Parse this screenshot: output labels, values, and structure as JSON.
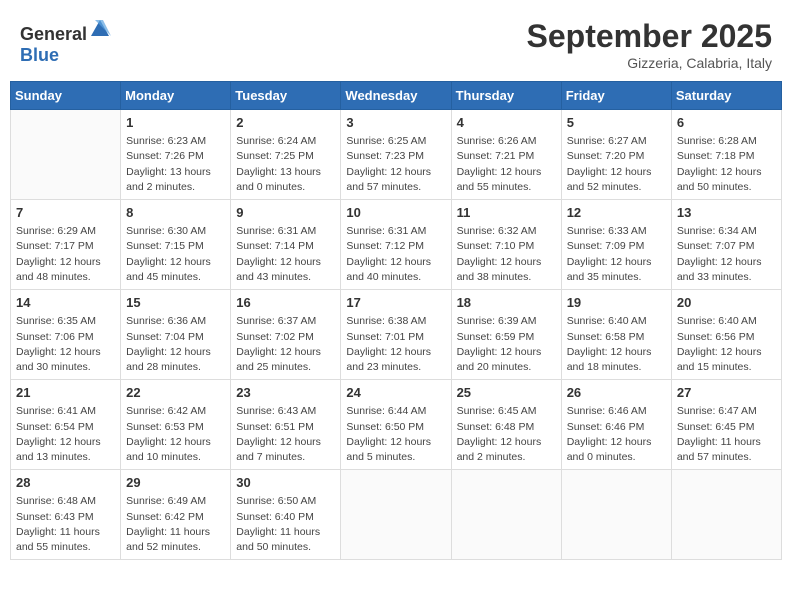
{
  "header": {
    "logo_general": "General",
    "logo_blue": "Blue",
    "month": "September 2025",
    "location": "Gizzeria, Calabria, Italy"
  },
  "weekdays": [
    "Sunday",
    "Monday",
    "Tuesday",
    "Wednesday",
    "Thursday",
    "Friday",
    "Saturday"
  ],
  "weeks": [
    [
      {
        "day": "",
        "info": ""
      },
      {
        "day": "1",
        "info": "Sunrise: 6:23 AM\nSunset: 7:26 PM\nDaylight: 13 hours\nand 2 minutes."
      },
      {
        "day": "2",
        "info": "Sunrise: 6:24 AM\nSunset: 7:25 PM\nDaylight: 13 hours\nand 0 minutes."
      },
      {
        "day": "3",
        "info": "Sunrise: 6:25 AM\nSunset: 7:23 PM\nDaylight: 12 hours\nand 57 minutes."
      },
      {
        "day": "4",
        "info": "Sunrise: 6:26 AM\nSunset: 7:21 PM\nDaylight: 12 hours\nand 55 minutes."
      },
      {
        "day": "5",
        "info": "Sunrise: 6:27 AM\nSunset: 7:20 PM\nDaylight: 12 hours\nand 52 minutes."
      },
      {
        "day": "6",
        "info": "Sunrise: 6:28 AM\nSunset: 7:18 PM\nDaylight: 12 hours\nand 50 minutes."
      }
    ],
    [
      {
        "day": "7",
        "info": "Sunrise: 6:29 AM\nSunset: 7:17 PM\nDaylight: 12 hours\nand 48 minutes."
      },
      {
        "day": "8",
        "info": "Sunrise: 6:30 AM\nSunset: 7:15 PM\nDaylight: 12 hours\nand 45 minutes."
      },
      {
        "day": "9",
        "info": "Sunrise: 6:31 AM\nSunset: 7:14 PM\nDaylight: 12 hours\nand 43 minutes."
      },
      {
        "day": "10",
        "info": "Sunrise: 6:31 AM\nSunset: 7:12 PM\nDaylight: 12 hours\nand 40 minutes."
      },
      {
        "day": "11",
        "info": "Sunrise: 6:32 AM\nSunset: 7:10 PM\nDaylight: 12 hours\nand 38 minutes."
      },
      {
        "day": "12",
        "info": "Sunrise: 6:33 AM\nSunset: 7:09 PM\nDaylight: 12 hours\nand 35 minutes."
      },
      {
        "day": "13",
        "info": "Sunrise: 6:34 AM\nSunset: 7:07 PM\nDaylight: 12 hours\nand 33 minutes."
      }
    ],
    [
      {
        "day": "14",
        "info": "Sunrise: 6:35 AM\nSunset: 7:06 PM\nDaylight: 12 hours\nand 30 minutes."
      },
      {
        "day": "15",
        "info": "Sunrise: 6:36 AM\nSunset: 7:04 PM\nDaylight: 12 hours\nand 28 minutes."
      },
      {
        "day": "16",
        "info": "Sunrise: 6:37 AM\nSunset: 7:02 PM\nDaylight: 12 hours\nand 25 minutes."
      },
      {
        "day": "17",
        "info": "Sunrise: 6:38 AM\nSunset: 7:01 PM\nDaylight: 12 hours\nand 23 minutes."
      },
      {
        "day": "18",
        "info": "Sunrise: 6:39 AM\nSunset: 6:59 PM\nDaylight: 12 hours\nand 20 minutes."
      },
      {
        "day": "19",
        "info": "Sunrise: 6:40 AM\nSunset: 6:58 PM\nDaylight: 12 hours\nand 18 minutes."
      },
      {
        "day": "20",
        "info": "Sunrise: 6:40 AM\nSunset: 6:56 PM\nDaylight: 12 hours\nand 15 minutes."
      }
    ],
    [
      {
        "day": "21",
        "info": "Sunrise: 6:41 AM\nSunset: 6:54 PM\nDaylight: 12 hours\nand 13 minutes."
      },
      {
        "day": "22",
        "info": "Sunrise: 6:42 AM\nSunset: 6:53 PM\nDaylight: 12 hours\nand 10 minutes."
      },
      {
        "day": "23",
        "info": "Sunrise: 6:43 AM\nSunset: 6:51 PM\nDaylight: 12 hours\nand 7 minutes."
      },
      {
        "day": "24",
        "info": "Sunrise: 6:44 AM\nSunset: 6:50 PM\nDaylight: 12 hours\nand 5 minutes."
      },
      {
        "day": "25",
        "info": "Sunrise: 6:45 AM\nSunset: 6:48 PM\nDaylight: 12 hours\nand 2 minutes."
      },
      {
        "day": "26",
        "info": "Sunrise: 6:46 AM\nSunset: 6:46 PM\nDaylight: 12 hours\nand 0 minutes."
      },
      {
        "day": "27",
        "info": "Sunrise: 6:47 AM\nSunset: 6:45 PM\nDaylight: 11 hours\nand 57 minutes."
      }
    ],
    [
      {
        "day": "28",
        "info": "Sunrise: 6:48 AM\nSunset: 6:43 PM\nDaylight: 11 hours\nand 55 minutes."
      },
      {
        "day": "29",
        "info": "Sunrise: 6:49 AM\nSunset: 6:42 PM\nDaylight: 11 hours\nand 52 minutes."
      },
      {
        "day": "30",
        "info": "Sunrise: 6:50 AM\nSunset: 6:40 PM\nDaylight: 11 hours\nand 50 minutes."
      },
      {
        "day": "",
        "info": ""
      },
      {
        "day": "",
        "info": ""
      },
      {
        "day": "",
        "info": ""
      },
      {
        "day": "",
        "info": ""
      }
    ]
  ]
}
